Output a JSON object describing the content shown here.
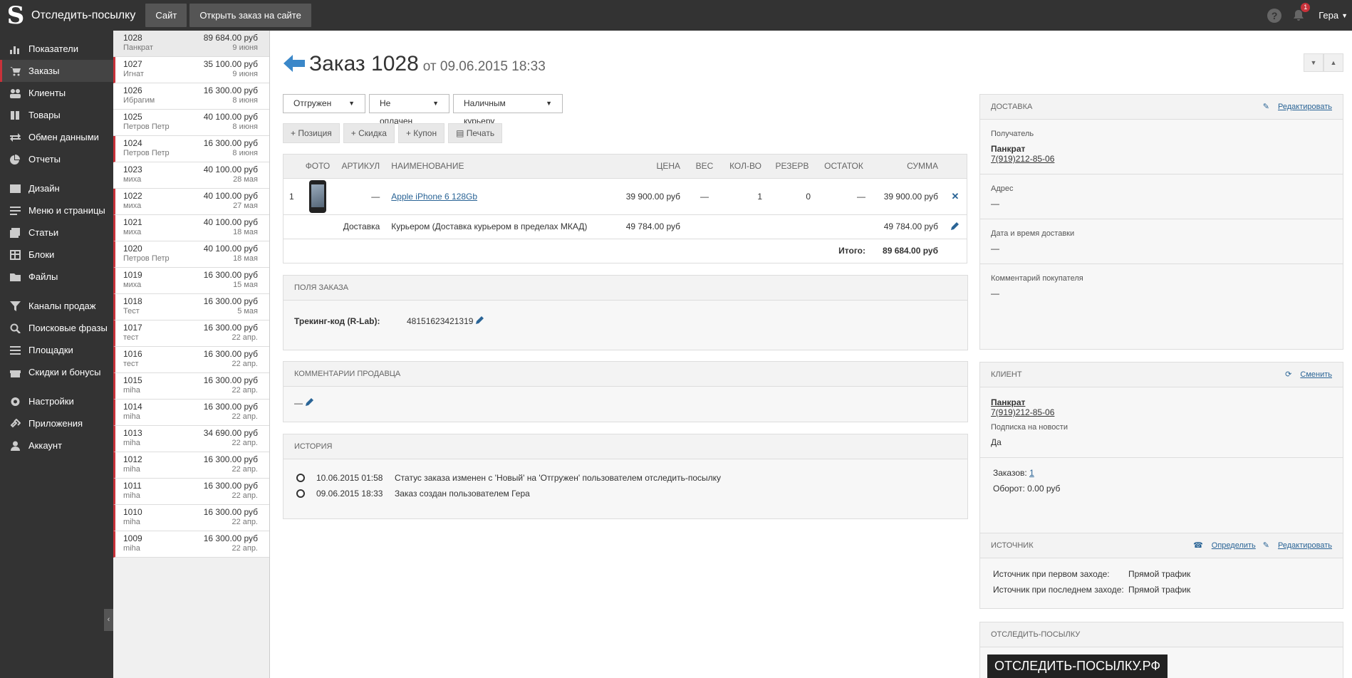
{
  "topbar": {
    "app_title": "Отследить-посылку",
    "buttons": [
      "Сайт",
      "Открыть заказ на сайте"
    ],
    "notifications_count": "1",
    "user_name": "Гера"
  },
  "sidebar": {
    "items": [
      {
        "label": "Показатели",
        "icon": "chart-icon"
      },
      {
        "label": "Заказы",
        "icon": "cart-icon"
      },
      {
        "label": "Клиенты",
        "icon": "users-icon"
      },
      {
        "label": "Товары",
        "icon": "book-icon"
      },
      {
        "label": "Обмен данными",
        "icon": "exchange-icon"
      },
      {
        "label": "Отчеты",
        "icon": "pie-icon"
      },
      {
        "label": "Дизайн",
        "icon": "image-icon"
      },
      {
        "label": "Меню и страницы",
        "icon": "menu-icon"
      },
      {
        "label": "Статьи",
        "icon": "articles-icon"
      },
      {
        "label": "Блоки",
        "icon": "grid-icon"
      },
      {
        "label": "Файлы",
        "icon": "folder-icon"
      },
      {
        "label": "Каналы продаж",
        "icon": "filter-icon"
      },
      {
        "label": "Поисковые фразы",
        "icon": "search-icon"
      },
      {
        "label": "Площадки",
        "icon": "list-icon"
      },
      {
        "label": "Скидки и бонусы",
        "icon": "gift-icon"
      },
      {
        "label": "Настройки",
        "icon": "gear-icon"
      },
      {
        "label": "Приложения",
        "icon": "link-icon"
      },
      {
        "label": "Аккаунт",
        "icon": "user-icon"
      }
    ]
  },
  "orders": [
    {
      "id": "1028",
      "sum": "89 684.00 руб",
      "customer": "Панкрат",
      "date": "9 июня"
    },
    {
      "id": "1027",
      "sum": "35 100.00 руб",
      "customer": "Игнат",
      "date": "9 июня"
    },
    {
      "id": "1026",
      "sum": "16 300.00 руб",
      "customer": "Ибрагим",
      "date": "8 июня"
    },
    {
      "id": "1025",
      "sum": "40 100.00 руб",
      "customer": "Петров Петр",
      "date": "8 июня"
    },
    {
      "id": "1024",
      "sum": "16 300.00 руб",
      "customer": "Петров Петр",
      "date": "8 июня"
    },
    {
      "id": "1023",
      "sum": "40 100.00 руб",
      "customer": "миха",
      "date": "28 мая"
    },
    {
      "id": "1022",
      "sum": "40 100.00 руб",
      "customer": "миха",
      "date": "27 мая"
    },
    {
      "id": "1021",
      "sum": "40 100.00 руб",
      "customer": "миха",
      "date": "18 мая"
    },
    {
      "id": "1020",
      "sum": "40 100.00 руб",
      "customer": "Петров Петр",
      "date": "18 мая"
    },
    {
      "id": "1019",
      "sum": "16 300.00 руб",
      "customer": "миха",
      "date": "15 мая"
    },
    {
      "id": "1018",
      "sum": "16 300.00 руб",
      "customer": "Тест",
      "date": "5 мая"
    },
    {
      "id": "1017",
      "sum": "16 300.00 руб",
      "customer": "тест",
      "date": "22 апр."
    },
    {
      "id": "1016",
      "sum": "16 300.00 руб",
      "customer": "тест",
      "date": "22 апр."
    },
    {
      "id": "1015",
      "sum": "16 300.00 руб",
      "customer": "miha",
      "date": "22 апр."
    },
    {
      "id": "1014",
      "sum": "16 300.00 руб",
      "customer": "miha",
      "date": "22 апр."
    },
    {
      "id": "1013",
      "sum": "34 690.00 руб",
      "customer": "miha",
      "date": "22 апр."
    },
    {
      "id": "1012",
      "sum": "16 300.00 руб",
      "customer": "miha",
      "date": "22 апр."
    },
    {
      "id": "1011",
      "sum": "16 300.00 руб",
      "customer": "miha",
      "date": "22 апр."
    },
    {
      "id": "1010",
      "sum": "16 300.00 руб",
      "customer": "miha",
      "date": "22 апр."
    },
    {
      "id": "1009",
      "sum": "16 300.00 руб",
      "customer": "miha",
      "date": "22 апр."
    }
  ],
  "order": {
    "title": "Заказ 1028",
    "subtitle": "от 09.06.2015 18:33",
    "status": "Отгружен",
    "payment": "Не оплачен",
    "payment_method": "Наличным курьеру",
    "actions": [
      "Позиция",
      "Скидка",
      "Купон",
      "Печать"
    ],
    "columns": [
      "ФОТО",
      "АРТИКУЛ",
      "НАИМЕНОВАНИЕ",
      "ЦЕНА",
      "ВЕС",
      "КОЛ-ВО",
      "РЕЗЕРВ",
      "ОСТАТОК",
      "СУММА"
    ],
    "item": {
      "num": "1",
      "article": "—",
      "name": "Apple iPhone 6 128Gb",
      "price": "39 900.00 руб",
      "weight": "—",
      "qty": "1",
      "reserve": "0",
      "stock": "—",
      "sum": "39 900.00 руб"
    },
    "delivery": {
      "label": "Доставка",
      "name": "Курьером (Доставка курьером в пределах МКАД)",
      "price": "49 784.00 руб",
      "sum": "49 784.00 руб"
    },
    "total_label": "Итого:",
    "total": "89 684.00 руб"
  },
  "fields_panel": {
    "title": "ПОЛЯ ЗАКАЗА",
    "label": "Трекинг-код (R-Lab):",
    "value": "48151623421319"
  },
  "comments_panel": {
    "title": "КОММЕНТАРИИ ПРОДАВЦА",
    "value": "—"
  },
  "history_panel": {
    "title": "ИСТОРИЯ",
    "entries": [
      {
        "time": "10.06.2015 01:58",
        "text": "Статус заказа изменен с 'Новый' на 'Отгружен' пользователем отследить-посылку"
      },
      {
        "time": "09.06.2015 18:33",
        "text": "Заказ создан пользователем Гера"
      }
    ]
  },
  "delivery_panel": {
    "title": "ДОСТАВКА",
    "edit": "Редактировать",
    "recipient_label": "Получатель",
    "recipient_name": "Панкрат",
    "recipient_phone": "7(919)212-85-06",
    "address_label": "Адрес",
    "address_value": "—",
    "datetime_label": "Дата и время доставки",
    "datetime_value": "—",
    "comment_label": "Комментарий покупателя",
    "comment_value": "—"
  },
  "client_panel": {
    "title": "КЛИЕНТ",
    "change": "Сменить",
    "name": "Панкрат",
    "phone": "7(919)212-85-06",
    "subscribe_label": "Подписка на новости",
    "subscribe_value": "Да",
    "orders_label": "Заказов:",
    "orders_value": "1",
    "turnover_label": "Оборот:",
    "turnover_value": "0.00 руб"
  },
  "source_panel": {
    "title": "ИСТОЧНИК",
    "detect": "Определить",
    "edit": "Редактировать",
    "first_label": "Источник при первом заходе:",
    "first_value": "Прямой трафик",
    "last_label": "Источник при последнем заходе:",
    "last_value": "Прямой трафик"
  },
  "tracking_panel": {
    "title": "ОТСЛЕДИТЬ-ПОСЫЛКУ",
    "brand": "ОТСЛЕДИТЬ-ПОСЫЛКУ.РФ"
  }
}
